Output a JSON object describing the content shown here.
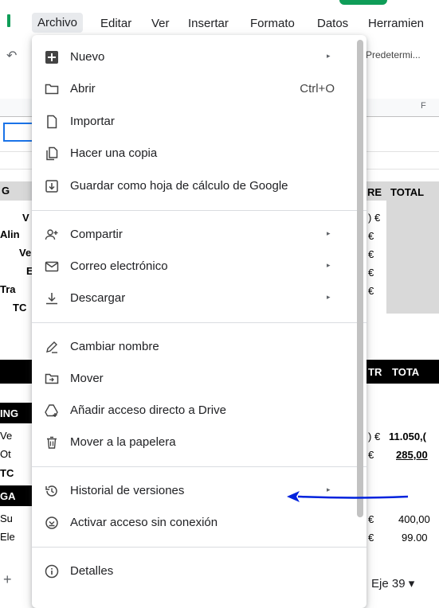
{
  "menubar": {
    "items": [
      "Archivo",
      "Editar",
      "Ver",
      "Insertar",
      "Formato",
      "Datos",
      "Herramien"
    ]
  },
  "toolbar": {
    "style_text": "Predetermi..."
  },
  "sheet": {
    "col_f": "F",
    "header_left": "G",
    "re_total": [
      "RE",
      "TOTAL"
    ],
    "left_rows": [
      "V",
      "Alin",
      "Ve",
      "E",
      "Tra",
      "TC"
    ],
    "euro_cells": [
      ") €",
      "€",
      "€",
      "€",
      "€"
    ],
    "dark1": {
      "left": "",
      "right1": "TR",
      "right2": "TOTA"
    },
    "ing": "ING",
    "ve": "Ve",
    "ot": "Ot",
    "tc2": "TC",
    "ga": "GA",
    "su": "Su",
    "ele": "Ele",
    "v1": ") €",
    "v1b": "11.050,(",
    "v2": "€",
    "v2b": "285,00",
    "v3": "€",
    "v3b": "400,00",
    "v4": "€",
    "v4b": "99.00",
    "sheet_tab": "Eje 39 ▾",
    "add_tab": "+"
  },
  "dropdown": {
    "items": [
      {
        "label": "Nuevo",
        "icon": "plus-box-icon",
        "submenu": true
      },
      {
        "label": "Abrir",
        "icon": "folder-icon",
        "shortcut": "Ctrl+O"
      },
      {
        "label": "Importar",
        "icon": "document-icon"
      },
      {
        "label": "Hacer una copia",
        "icon": "copy-icon"
      },
      {
        "label": "Guardar como hoja de cálculo de Google",
        "icon": "save-arrow-icon"
      },
      {
        "label": "Compartir",
        "icon": "add-person-icon",
        "submenu": true
      },
      {
        "label": "Correo electrónico",
        "icon": "mail-icon",
        "submenu": true
      },
      {
        "label": "Descargar",
        "icon": "download-icon",
        "submenu": true
      },
      {
        "label": "Cambiar nombre",
        "icon": "pencil-icon"
      },
      {
        "label": "Mover",
        "icon": "move-folder-icon"
      },
      {
        "label": "Añadir acceso directo a Drive",
        "icon": "drive-shortcut-icon"
      },
      {
        "label": "Mover a la papelera",
        "icon": "trash-icon"
      },
      {
        "label": "Historial de versiones",
        "icon": "history-icon",
        "submenu": true
      },
      {
        "label": "Activar acceso sin conexión",
        "icon": "offline-icon"
      },
      {
        "label": "Detalles",
        "icon": "info-icon"
      }
    ]
  },
  "colors": {
    "accent": "#1a73e8",
    "annotation": "#0022dd",
    "brand": "#0f9d58"
  }
}
